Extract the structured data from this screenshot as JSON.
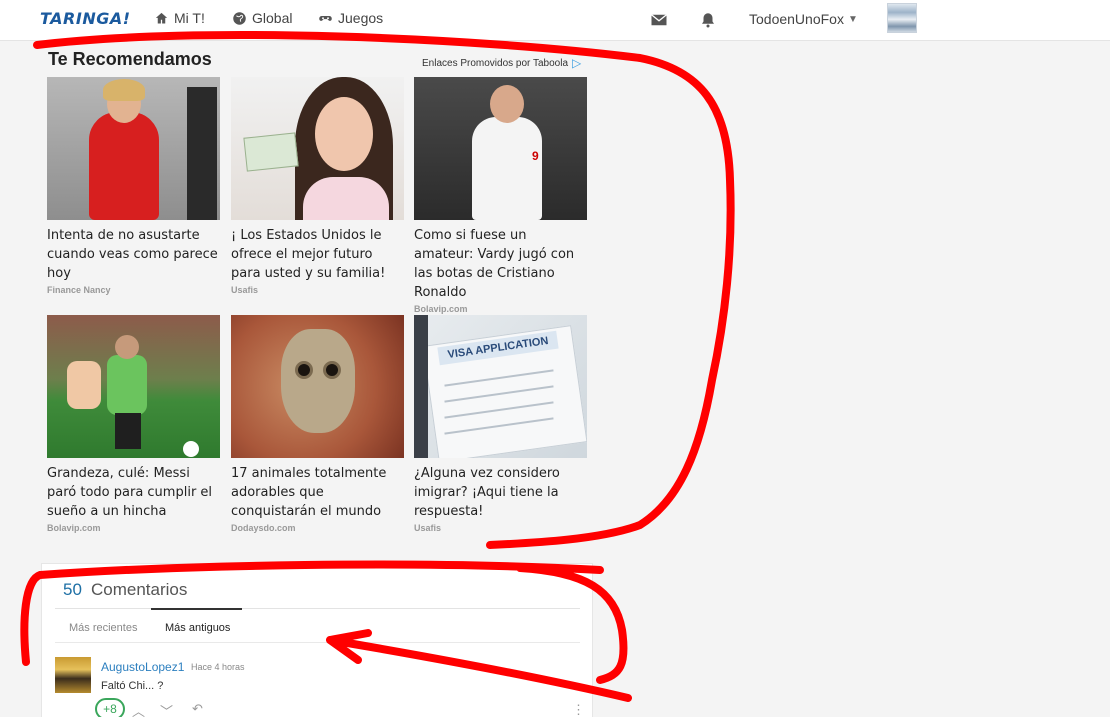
{
  "topbar": {
    "logo": "TARINGA!",
    "nav": [
      {
        "label": "Mi T!",
        "icon": "home-icon"
      },
      {
        "label": "Global",
        "icon": "globe-icon"
      },
      {
        "label": "Juegos",
        "icon": "gamepad-icon"
      }
    ],
    "mail_icon": "mail-icon",
    "bell_icon": "bell-icon",
    "username": "TodoenUnoFox"
  },
  "recommendations": {
    "title": "Te Recomendamos",
    "promo": "Enlaces Promovidos por Taboola",
    "items": [
      {
        "title": "Intenta de no asustarte cuando veas como parece hoy",
        "source": "Finance Nancy"
      },
      {
        "title": "¡ Los Estados Unidos le ofrece el mejor futuro para usted y su familia!",
        "source": "Usafis"
      },
      {
        "title": "Como si fuese un amateur: Vardy jugó con las botas de Cristiano Ronaldo",
        "source": "Bolavip.com"
      },
      {
        "title": "Grandeza, culé: Messi paró todo para cumplir el sueño a un hincha",
        "source": "Bolavip.com"
      },
      {
        "title": "17 animales totalmente adorables que conquistarán el mundo",
        "source": "Dodaysdo.com"
      },
      {
        "title": "¿Alguna vez considero imigrar? ¡Aqui tiene la respuesta!",
        "source": "Usafis"
      }
    ]
  },
  "comments": {
    "count": "50",
    "label": "Comentarios",
    "tabs": [
      "Más recientes",
      "Más antiguos"
    ],
    "active_tab": "Más antiguos",
    "first": {
      "user": "AugustoLopez1",
      "time": "Hace 4 horas",
      "text": "Faltó Chi... ?",
      "score": "+8"
    }
  },
  "colors": {
    "brand": "#1b5a9e",
    "annotation": "#ff0000",
    "score_green": "#3aa65b",
    "link": "#2c7fbf"
  }
}
